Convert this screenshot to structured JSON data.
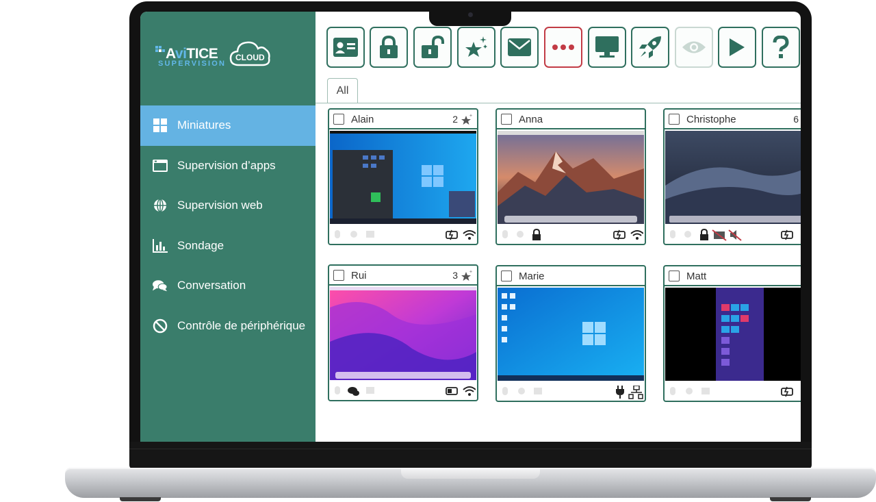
{
  "app": {
    "logo_main_prefix": "A",
    "logo_main_ai": "vi",
    "logo_main_rest": "TICE",
    "logo_sub": "SUPERVISION",
    "logo_cloud": "CLOUD",
    "accent": "#3a7d6b",
    "active_nav_color": "#64b3e3"
  },
  "sidebar": {
    "items": [
      {
        "label": "Miniatures",
        "icon": "grid-icon",
        "active": true
      },
      {
        "label": "Supervision d’apps",
        "icon": "window-icon"
      },
      {
        "label": "Supervision web",
        "icon": "globe-icon"
      },
      {
        "label": "Sondage",
        "icon": "bar-chart-icon"
      },
      {
        "label": "Conversation",
        "icon": "chat-icon"
      },
      {
        "label": "Contrôle de périphérique",
        "icon": "prohibited-icon"
      }
    ]
  },
  "toolbar": {
    "buttons": [
      {
        "icon": "id-card-icon"
      },
      {
        "icon": "lock-icon"
      },
      {
        "icon": "unlock-icon"
      },
      {
        "icon": "star-sparkle-icon"
      },
      {
        "icon": "mail-icon"
      },
      {
        "icon": "more-dots-icon"
      },
      {
        "icon": "monitor-icon"
      },
      {
        "icon": "rocket-icon"
      },
      {
        "icon": "eye-icon"
      },
      {
        "icon": "play-icon"
      },
      {
        "icon": "help-icon"
      }
    ]
  },
  "tabs": [
    {
      "label": "All",
      "active": true
    }
  ],
  "cards": [
    {
      "name": "Alain",
      "count": "2",
      "screen": "windows-dark"
    },
    {
      "name": "Anna",
      "count": "",
      "screen": "mac-mountain"
    },
    {
      "name": "Christophe",
      "count": "6",
      "screen": "mac-dunes"
    },
    {
      "name": "Rui",
      "count": "3",
      "screen": "mac-pink"
    },
    {
      "name": "Marie",
      "count": "",
      "screen": "windows-blue"
    },
    {
      "name": "Matt",
      "count": "",
      "screen": "windows8"
    }
  ]
}
